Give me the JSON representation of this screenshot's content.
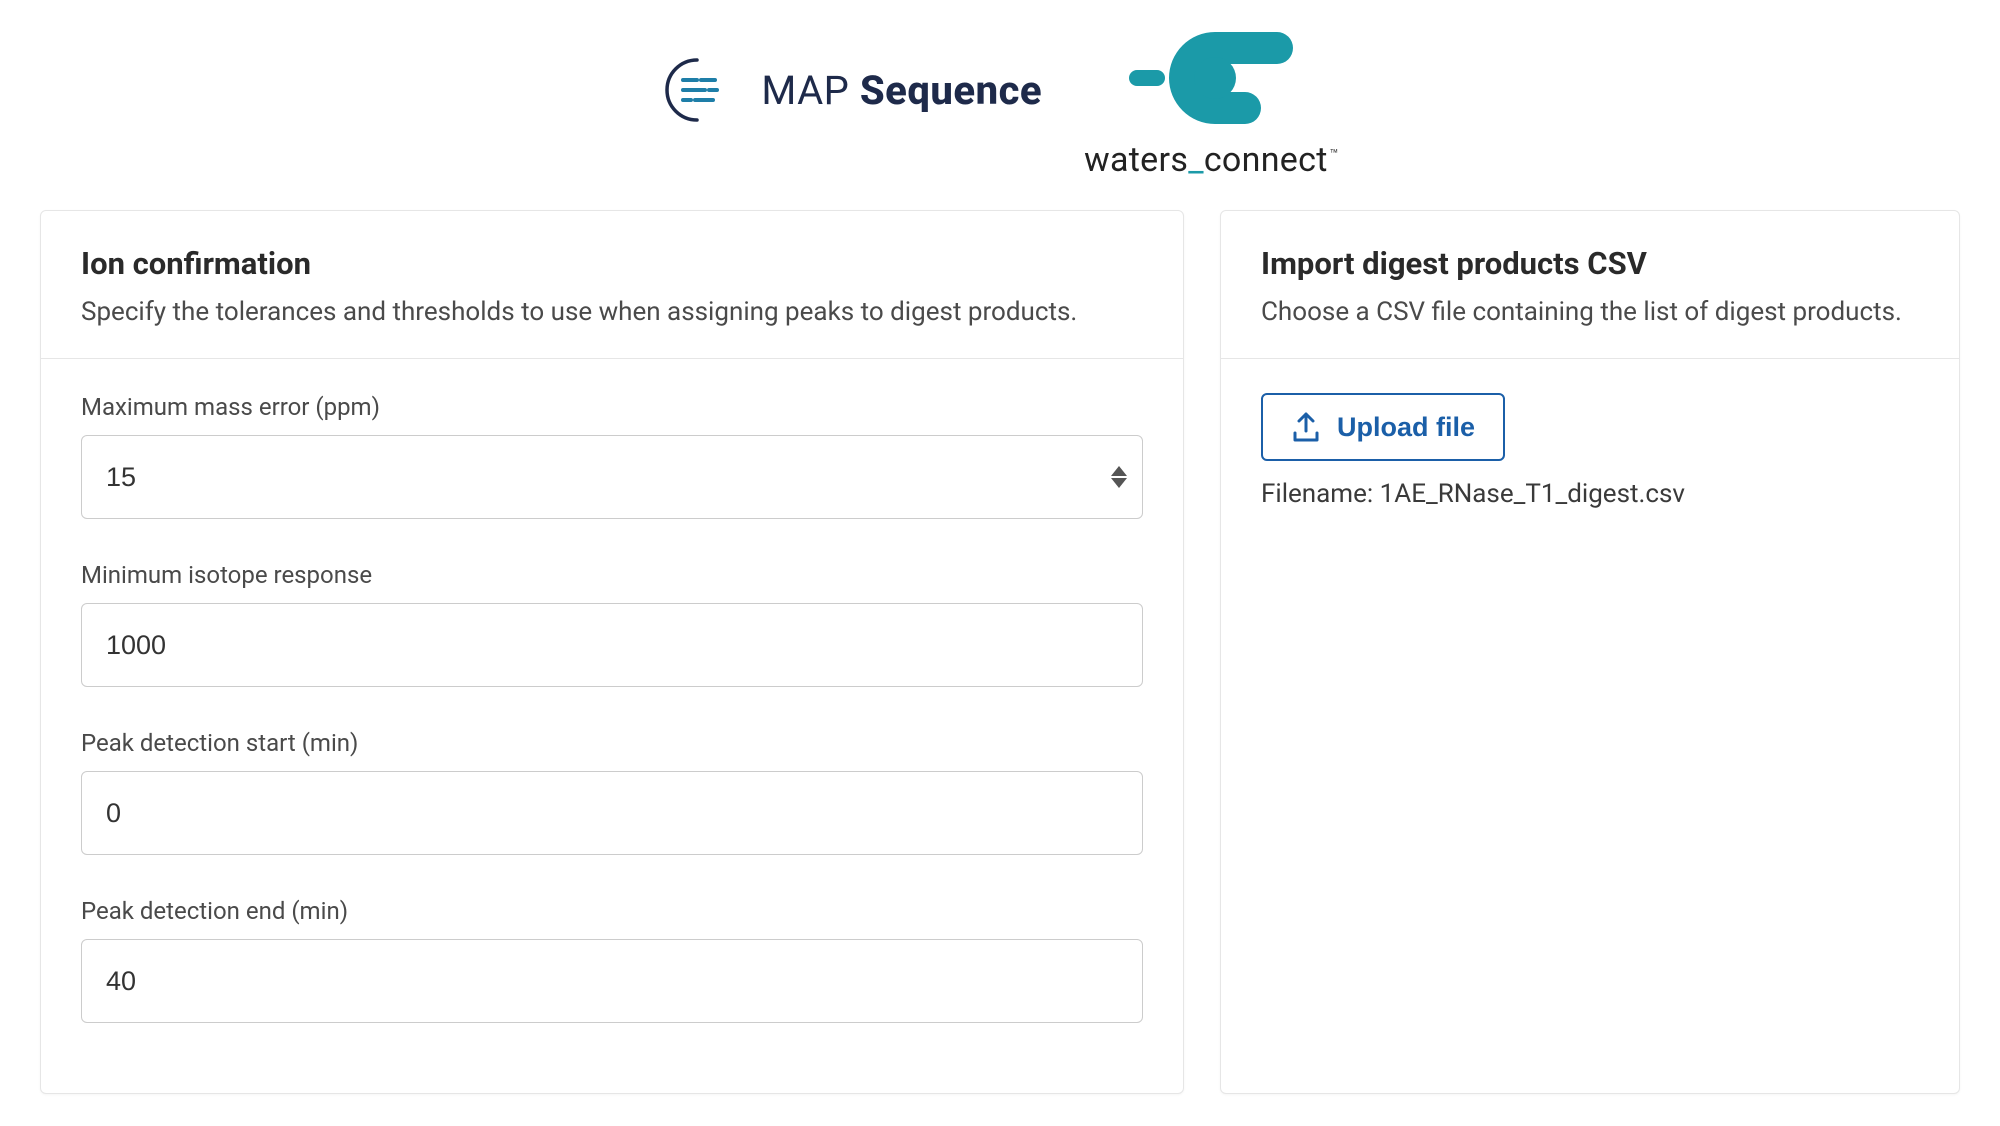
{
  "header": {
    "map_light": "MAP ",
    "map_bold": "Sequence",
    "waters_pre": "waters",
    "waters_underscore": "_",
    "waters_post": "connect",
    "waters_tm": "™"
  },
  "ion_panel": {
    "title": "Ion confirmation",
    "subtitle": "Specify the tolerances and thresholds to use when assigning peaks to digest products.",
    "fields": {
      "max_mass_error": {
        "label": "Maximum mass error (ppm)",
        "value": "15"
      },
      "min_isotope_response": {
        "label": "Minimum isotope response",
        "value": "1000"
      },
      "peak_detect_start": {
        "label": "Peak detection start (min)",
        "value": "0"
      },
      "peak_detect_end": {
        "label": "Peak detection end (min)",
        "value": "40"
      }
    }
  },
  "import_panel": {
    "title": "Import digest products CSV",
    "subtitle": "Choose a CSV file containing the list of digest products.",
    "upload_label": "Upload file",
    "filename_label": "Filename: ",
    "filename_value": "1AE_RNase_T1_digest.csv"
  }
}
